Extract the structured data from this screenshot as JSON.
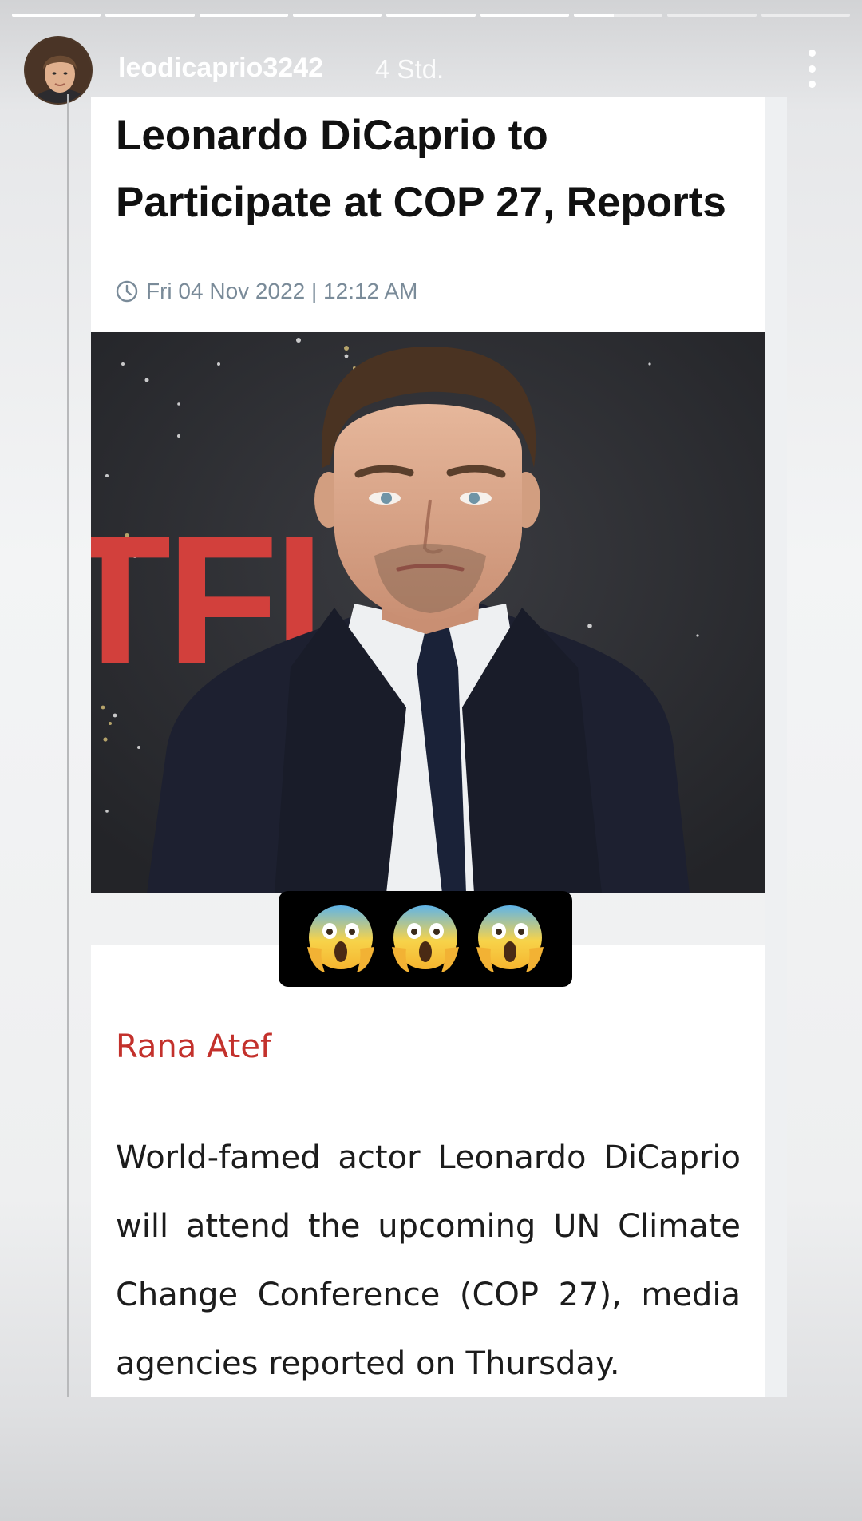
{
  "story": {
    "segments": [
      {
        "fill": 1
      },
      {
        "fill": 1
      },
      {
        "fill": 1
      },
      {
        "fill": 1
      },
      {
        "fill": 1
      },
      {
        "fill": 1
      },
      {
        "fill": 0.45
      },
      {
        "fill": 0
      },
      {
        "fill": 0
      }
    ],
    "username": "leodicaprio3242",
    "time_ago": "4 Std.",
    "avatar_icon": "profile-photo",
    "more_icon": "vertical-ellipsis-icon",
    "sticker_emojis": [
      "😱",
      "😱",
      "😱"
    ]
  },
  "article": {
    "headline": "Leonardo DiCaprio to Participate at COP 27, Reports",
    "date": "Fri 04 Nov 2022 | 12:12 AM",
    "date_icon": "clock-icon",
    "author": "Rana Atef",
    "body": "World-famed actor Leonardo DiCaprio will attend the upcoming UN Climate Change Conference (COP 27), media agencies reported on Thursday.",
    "photo_letters": "TFL"
  },
  "colors": {
    "author": "#c3312c",
    "dateline": "#7a8b99",
    "photo_background": "#2f3034"
  }
}
